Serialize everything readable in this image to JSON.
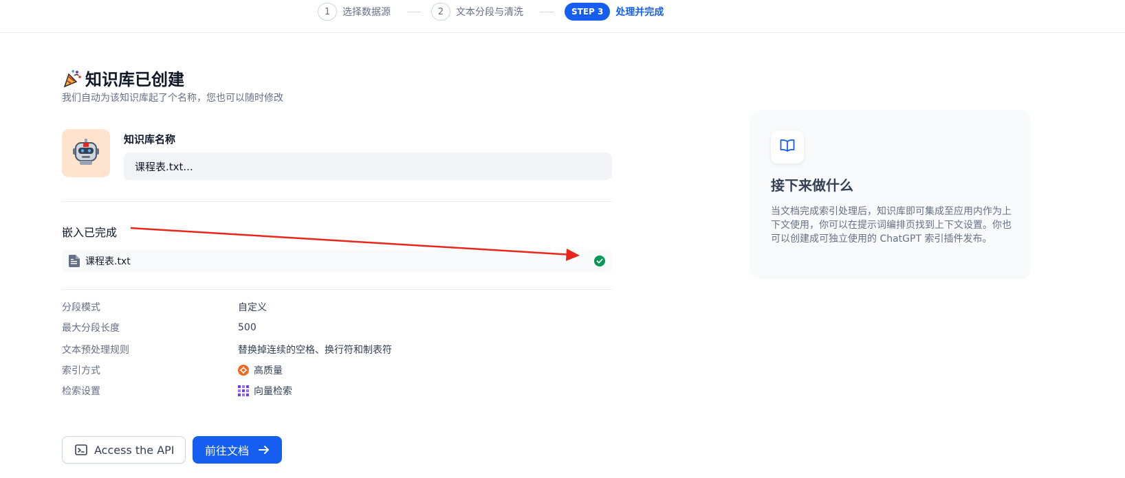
{
  "stepper": {
    "steps": [
      {
        "num": "1",
        "label": "选择数据源"
      },
      {
        "num": "2",
        "label": "文本分段与清洗"
      },
      {
        "num": "STEP 3",
        "label": "处理并完成"
      }
    ]
  },
  "header": {
    "title": "知识库已创建",
    "subtitle": "我们自动为该知识库起了个名称，您也可以随时修改"
  },
  "dataset": {
    "name_label": "知识库名称",
    "name_value": "课程表.txt..."
  },
  "embedding": {
    "title": "嵌入已完成",
    "files": [
      {
        "name": "课程表.txt",
        "status_color": "#039855"
      }
    ]
  },
  "settings": [
    {
      "key": "分段模式",
      "value": "自定义",
      "icon": ""
    },
    {
      "key": "最大分段长度",
      "value": "500",
      "icon": ""
    },
    {
      "key": "文本预处理规则",
      "value": "替换掉连续的空格、换行符和制表符",
      "icon": ""
    },
    {
      "key": "索引方式",
      "value": "高质量",
      "icon": "high-quality-icon"
    },
    {
      "key": "检索设置",
      "value": "向量检索",
      "icon": "vector-search-icon"
    }
  ],
  "actions": {
    "api_label": "Access the API",
    "doc_label": "前往文档"
  },
  "next_steps": {
    "title": "接下来做什么",
    "description": "当文档完成索引处理后，知识库即可集成至应用内作为上下文使用，你可以在提示词编排页找到上下文设置。你也可以创建成可独立使用的 ChatGPT 索引插件发布。"
  },
  "colors": {
    "primary": "#155eef",
    "success": "#039855",
    "annotation_arrow": "#e8261b",
    "avatar_bg": "#fee4cf"
  }
}
